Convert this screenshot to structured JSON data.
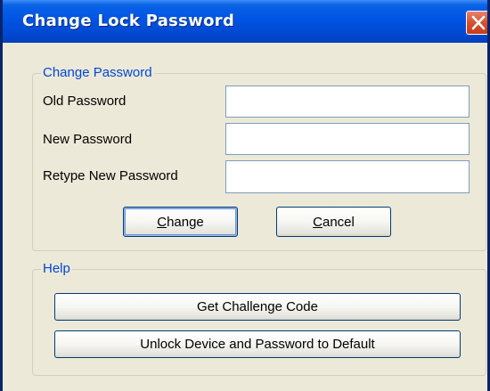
{
  "window": {
    "title": "Change Lock Password",
    "close_icon": "close-icon"
  },
  "change_group": {
    "title": "Change Password",
    "old_password_label": "Old Password",
    "old_password_value": "",
    "new_password_label": "New Password",
    "new_password_value": "",
    "retype_label": "Retype New Password",
    "retype_value": "",
    "change_button": {
      "mnemonic": "C",
      "rest": "hange"
    },
    "cancel_button": {
      "mnemonic": "C",
      "rest": "ancel"
    }
  },
  "help_group": {
    "title": "Help",
    "challenge_button": "Get Challenge Code",
    "unlock_button": "Unlock Device and Password to Default"
  },
  "colors": {
    "titlebar": "#0054e3",
    "group_title": "#0046d5",
    "dialog_bg": "#ece9d8",
    "close_button": "#d9502f"
  }
}
